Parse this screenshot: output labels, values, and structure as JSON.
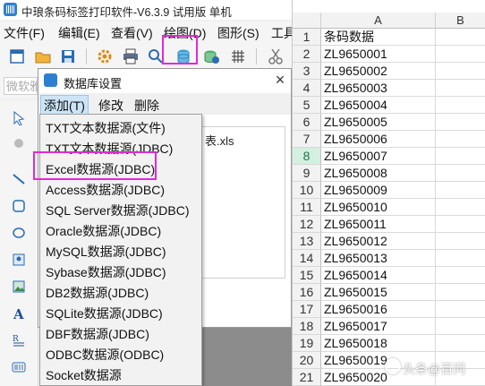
{
  "app": {
    "title": "中琅条码标签打印软件-V6.3.9 试用版 单机",
    "menu": [
      "文件(F)",
      "编辑(E)",
      "查看(V)",
      "绘图(D)",
      "图形(S)",
      "工具"
    ],
    "font_placeholder": "微软雅"
  },
  "dialog": {
    "title": "数据库设置",
    "close": "×",
    "tabs": [
      "添加(T)",
      "修改",
      "删除"
    ],
    "file_name": "表.xls"
  },
  "dropdown": {
    "items": [
      "TXT文本数据源(文件)",
      "TXT文本数据源(JDBC)",
      "Excel数据源(JDBC)",
      "Access数据源(JDBC)",
      "SQL Server数据源(JDBC)",
      "Oracle数据源(JDBC)",
      "MySQL数据源(JDBC)",
      "Sybase数据源(JDBC)",
      "DB2数据源(JDBC)",
      "SQLite数据源(JDBC)",
      "DBF数据源(JDBC)",
      "ODBC数据源(ODBC)",
      "Socket数据源"
    ],
    "highlighted": "Excel数据源(JDBC)"
  },
  "sheet": {
    "columns": [
      "A",
      "B"
    ],
    "rows": [
      {
        "n": "1",
        "a": "条码数据"
      },
      {
        "n": "2",
        "a": "ZL9650001"
      },
      {
        "n": "3",
        "a": "ZL9650002"
      },
      {
        "n": "4",
        "a": "ZL9650003"
      },
      {
        "n": "5",
        "a": "ZL9650004"
      },
      {
        "n": "6",
        "a": "ZL9650005"
      },
      {
        "n": "7",
        "a": "ZL9650006"
      },
      {
        "n": "8",
        "a": "ZL9650007"
      },
      {
        "n": "9",
        "a": "ZL9650008"
      },
      {
        "n": "10",
        "a": "ZL9650009"
      },
      {
        "n": "11",
        "a": "ZL9650010"
      },
      {
        "n": "12",
        "a": "ZL9650011"
      },
      {
        "n": "13",
        "a": "ZL9650012"
      },
      {
        "n": "14",
        "a": "ZL9650013"
      },
      {
        "n": "15",
        "a": "ZL9650014"
      },
      {
        "n": "16",
        "a": "ZL9650015"
      },
      {
        "n": "17",
        "a": "ZL9650016"
      },
      {
        "n": "18",
        "a": "ZL9650017"
      },
      {
        "n": "19",
        "a": "ZL9650018"
      },
      {
        "n": "20",
        "a": "ZL9650019"
      },
      {
        "n": "21",
        "a": "ZL9650020"
      }
    ],
    "selected_row": "8"
  },
  "watermark": "头条@百问",
  "colors": {
    "highlight": "#e02ad6",
    "selected_row": "#d3f0e0",
    "accent": "#2f7fd0"
  }
}
